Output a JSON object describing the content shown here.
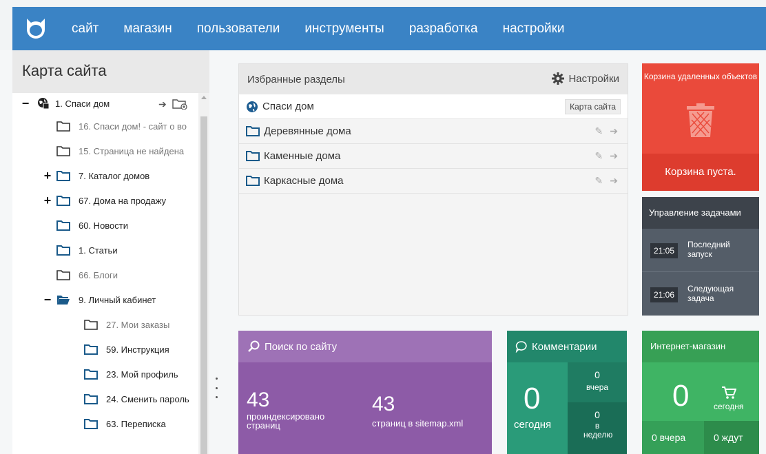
{
  "nav": {
    "logo": "cat-logo-icon",
    "items": [
      "сайт",
      "магазин",
      "пользователи",
      "инструменты",
      "разработка",
      "настройки"
    ]
  },
  "sidebar": {
    "title": "Карта сайта",
    "tree": [
      {
        "label": "1. Спаси дом",
        "toggle": "−",
        "icon": "globe-home-icon"
      },
      {
        "label": "16. Спаси дом! - сайт о во",
        "muted": true
      },
      {
        "label": "15. Страница не найдена",
        "muted": true
      },
      {
        "label": "7. Каталог домов",
        "toggle": "+"
      },
      {
        "label": "67. Дома на продажу",
        "toggle": "+"
      },
      {
        "label": "60. Новости"
      },
      {
        "label": "1. Статьи"
      },
      {
        "label": "66. Блоги",
        "muted": true
      },
      {
        "label": "9. Личный кабинет",
        "toggle": "−"
      },
      {
        "label": "27. Мои заказы",
        "muted": true
      },
      {
        "label": "59. Инструкция"
      },
      {
        "label": "23. Мой профиль"
      },
      {
        "label": "24. Сменить пароль"
      },
      {
        "label": "63. Переписка"
      }
    ]
  },
  "favorites": {
    "title": "Избранные разделы",
    "settings_label": "Настройки",
    "rows": [
      {
        "label": "Спаси дом",
        "badge": "Карта сайта"
      },
      {
        "label": "Деревянные дома"
      },
      {
        "label": "Каменные дома"
      },
      {
        "label": "Каркасные дома"
      }
    ]
  },
  "trash": {
    "title": "Корзина удаленных объектов",
    "status": "Корзина пуста."
  },
  "tasks": {
    "title": "Управление задачами",
    "rows": [
      {
        "time": "21:05",
        "label": "Последний запуск"
      },
      {
        "time": "21:06",
        "label": "Следующая задача"
      }
    ]
  },
  "search": {
    "title": "Поиск по сайту",
    "indexed_count": "43",
    "indexed_label": "проиндексировано страниц",
    "sitemap_count": "43",
    "sitemap_label": "страниц в sitemap.xml"
  },
  "comments": {
    "title": "Комментарии",
    "today_count": "0",
    "today_label": "сегодня",
    "yesterday_count": "0",
    "yesterday_label": "вчера",
    "week_count": "0",
    "week_label": "в неделю"
  },
  "shop": {
    "title": "Интернет-магазин",
    "today_count": "0",
    "today_label": "сегодня",
    "yesterday_label": "0  вчера",
    "waiting_label": "0  ждут"
  },
  "colors": {
    "nav": "#3a83c5",
    "trash": "#ea4a3b",
    "tasks": "#545d68",
    "search": "#8d5ba7",
    "comments": "#2a9b79",
    "shop": "#3fb464"
  }
}
